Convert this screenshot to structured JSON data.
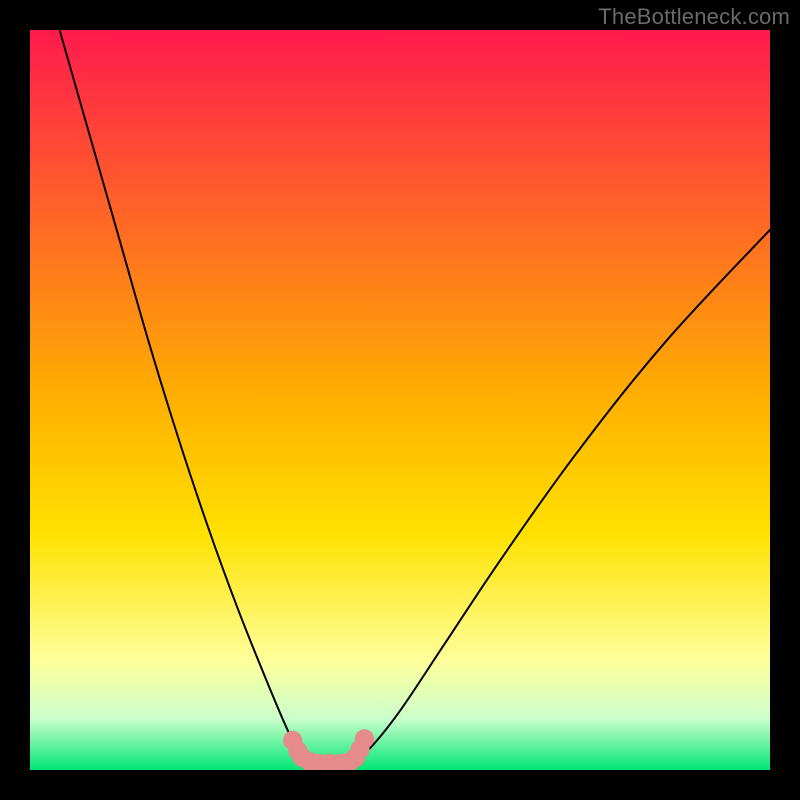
{
  "watermark": "TheBottleneck.com",
  "colors": {
    "bg_black": "#000000",
    "grad_top": "#ff1a4d",
    "grad_yellow": "#ffe100",
    "grad_lightyellow": "#ffff99",
    "grad_green": "#00e676",
    "curve_stroke": "#000000",
    "marker_fill": "#e58b8b",
    "watermark": "#6a6a6a"
  },
  "chart_data": {
    "type": "line",
    "title": "",
    "xlabel": "",
    "ylabel": "",
    "xlim": [
      0,
      100
    ],
    "ylim": [
      0,
      100
    ],
    "grid": false,
    "legend": false,
    "series": [
      {
        "name": "left_curve",
        "x": [
          4,
          8,
          12,
          16,
          20,
          24,
          28,
          32,
          35,
          36.5,
          37.5
        ],
        "values": [
          100,
          86,
          72,
          58,
          45,
          33,
          22,
          12,
          5,
          2.5,
          1.5
        ]
      },
      {
        "name": "right_curve",
        "x": [
          44,
          46,
          50,
          56,
          64,
          74,
          86,
          100
        ],
        "values": [
          1.5,
          3,
          8,
          17,
          29,
          43,
          58,
          73
        ]
      },
      {
        "name": "valley_floor",
        "x": [
          37.5,
          39,
          41,
          43,
          44
        ],
        "values": [
          1.5,
          1.0,
          1.0,
          1.0,
          1.5
        ]
      }
    ],
    "markers": {
      "name": "valley_markers",
      "points": [
        {
          "x": 35.5,
          "y": 4.0
        },
        {
          "x": 36.2,
          "y": 2.6
        },
        {
          "x": 36.8,
          "y": 1.7
        },
        {
          "x": 37.8,
          "y": 1.1
        },
        {
          "x": 39.0,
          "y": 0.9
        },
        {
          "x": 40.5,
          "y": 0.9
        },
        {
          "x": 42.0,
          "y": 0.9
        },
        {
          "x": 43.2,
          "y": 1.1
        },
        {
          "x": 44.0,
          "y": 1.7
        },
        {
          "x": 44.6,
          "y": 2.8
        },
        {
          "x": 45.2,
          "y": 4.2
        }
      ]
    },
    "background_gradient": [
      {
        "stop": 0.0,
        "color": "#ff1a4d"
      },
      {
        "stop": 0.5,
        "color": "#ffb000"
      },
      {
        "stop": 0.68,
        "color": "#ffe100"
      },
      {
        "stop": 0.85,
        "color": "#ffff99"
      },
      {
        "stop": 0.93,
        "color": "#ccffcc"
      },
      {
        "stop": 1.0,
        "color": "#00e676"
      }
    ]
  }
}
